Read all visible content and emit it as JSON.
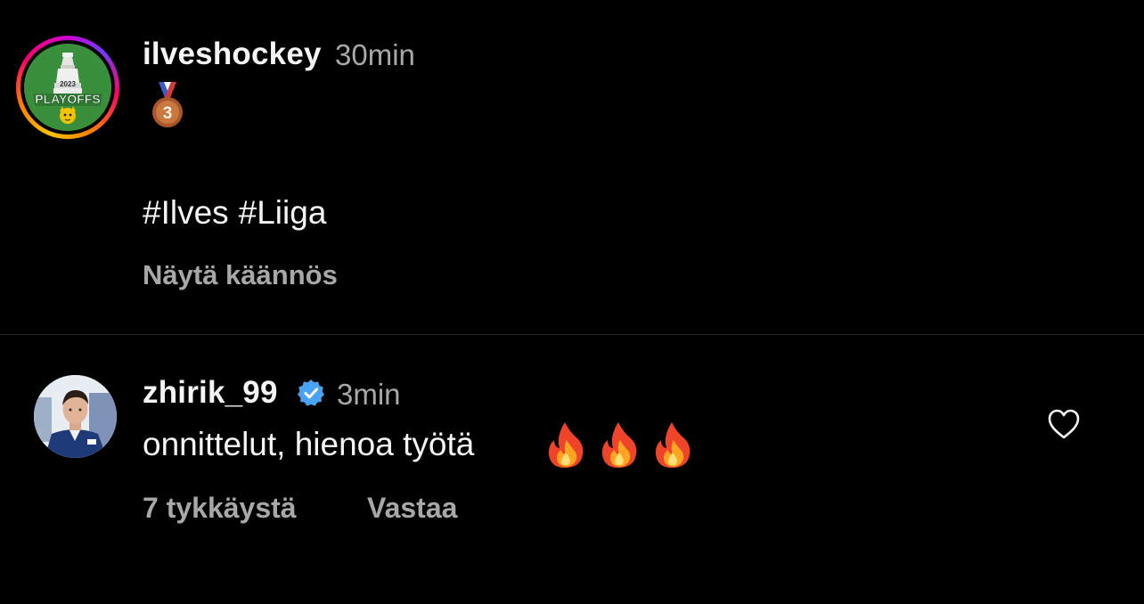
{
  "caption": {
    "username": "ilveshockey",
    "time": "30min",
    "medal_label": "3",
    "hashtags": [
      "#Ilves",
      "#Liiga"
    ],
    "translate_label": "Näytä käännös",
    "avatar": {
      "year": "2023",
      "label": "PLAYOFFS"
    }
  },
  "comment": {
    "username": "zhirik_99",
    "verified": true,
    "time": "3min",
    "text": "onnittelut, hienoa työtä",
    "emoji": "fire-icon x3",
    "likes_label": "7 tykkäystä",
    "reply_label": "Vastaa"
  },
  "colors": {
    "background": "#000000",
    "primary_text": "#f5f5f5",
    "secondary_text": "#a8a8a8",
    "divider": "#262626",
    "verified_blue": "#4aa3f0",
    "avatar_green": "#3a8f3c"
  }
}
